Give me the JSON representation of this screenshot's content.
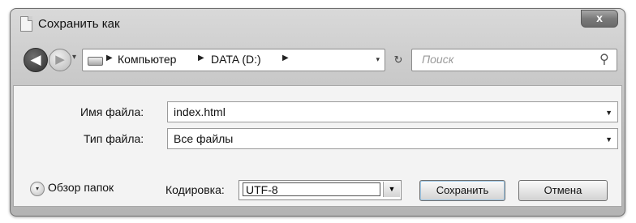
{
  "window": {
    "title": "Сохранить как",
    "close_label": "x"
  },
  "nav": {
    "back_glyph": "◀",
    "forward_glyph": "▶",
    "history_glyph": "▾",
    "breadcrumb": [
      "Компьютер",
      "DATA (D:)"
    ],
    "separator": "▶",
    "dropdown_glyph": "▾",
    "refresh_glyph": "↻",
    "search_placeholder": "Поиск",
    "search_glyph": "⚲"
  },
  "form": {
    "filename_label": "Имя файла:",
    "filename_value": "index.html",
    "filetype_label": "Тип файла:",
    "filetype_value": "Все файлы",
    "arrow_glyph": "▼"
  },
  "footer": {
    "browse_label": "Обзор папок",
    "browse_glyph": "▾",
    "encoding_label": "Кодировка:",
    "encoding_value": "UTF-8",
    "save_label": "Сохранить",
    "cancel_label": "Отмена"
  }
}
